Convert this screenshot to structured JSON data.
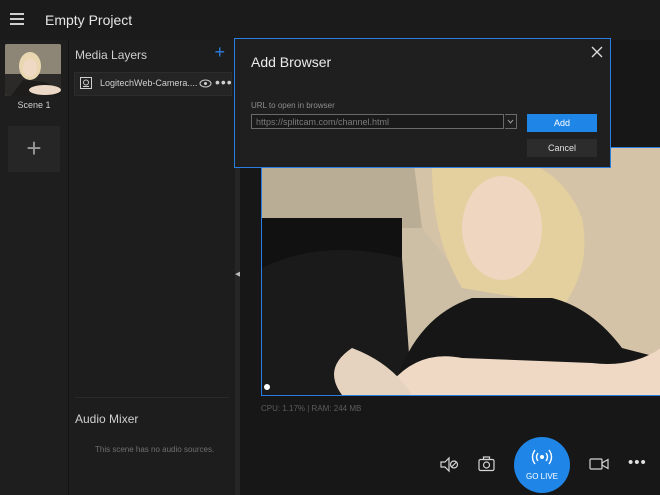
{
  "app": {
    "title": "Empty Project"
  },
  "scenes": {
    "items": [
      {
        "label": "Scene 1"
      }
    ]
  },
  "media_layers": {
    "title": "Media Layers",
    "items": [
      {
        "label": "LogitechWeb-Camera...."
      }
    ]
  },
  "audio_mixer": {
    "title": "Audio Mixer",
    "empty_text": "This scene has no audio sources."
  },
  "status": {
    "stats": "CPU: 1.17% | RAM: 244 MB"
  },
  "controls": {
    "golive_label": "GO LIVE"
  },
  "dialog": {
    "title": "Add Browser",
    "url_label": "URL to open in browser",
    "url_value": "https://splitcam.com/channel.html",
    "add_label": "Add",
    "cancel_label": "Cancel"
  },
  "colors": {
    "accent": "#1f86e8",
    "background": "#1c1c1c",
    "panel": "#1d1d1d"
  },
  "icons": [
    "menu-icon",
    "plus-icon",
    "camera-source-icon",
    "eye-icon",
    "more-icon",
    "speaker-mute-icon",
    "snapshot-icon",
    "broadcast-icon",
    "video-camera-icon",
    "close-icon",
    "chevron-down-icon"
  ]
}
